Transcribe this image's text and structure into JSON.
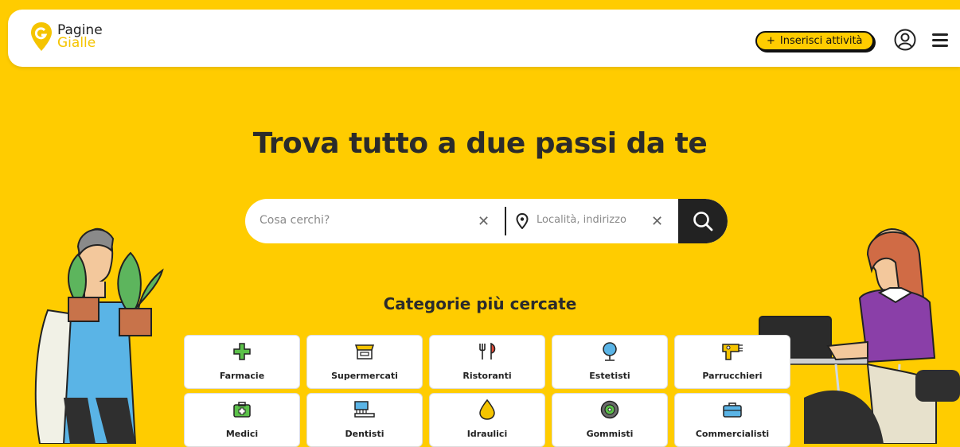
{
  "brand": {
    "line1": "Pagine",
    "line2": "Gialle",
    "accent": "#FFCC00",
    "dark": "#222222"
  },
  "header": {
    "add_button": "Inserisci attività",
    "add_icon": "plus-icon",
    "user_icon": "user-icon",
    "menu_icon": "menu-icon"
  },
  "hero": {
    "title": "Trova tutto a due passi da te"
  },
  "search": {
    "what_placeholder": "Cosa cerchi?",
    "where_placeholder": "Località, indirizzo",
    "clear_icon": "close-icon",
    "location_icon": "location-pin-icon",
    "submit_icon": "search-icon"
  },
  "categories": {
    "title": "Categorie più cercate",
    "items": [
      {
        "label": "Farmacie",
        "icon": "pharmacy-cross-icon"
      },
      {
        "label": "Supermercati",
        "icon": "store-icon"
      },
      {
        "label": "Ristoranti",
        "icon": "fork-knife-icon"
      },
      {
        "label": "Estetisti",
        "icon": "mirror-icon"
      },
      {
        "label": "Parrucchieri",
        "icon": "hair-dryer-icon"
      },
      {
        "label": "Medici",
        "icon": "medical-kit-icon"
      },
      {
        "label": "Dentisti",
        "icon": "toothbrush-icon"
      },
      {
        "label": "Idraulici",
        "icon": "water-drop-icon"
      },
      {
        "label": "Gommisti",
        "icon": "tire-icon"
      },
      {
        "label": "Commercialisti",
        "icon": "briefcase-icon"
      }
    ]
  }
}
